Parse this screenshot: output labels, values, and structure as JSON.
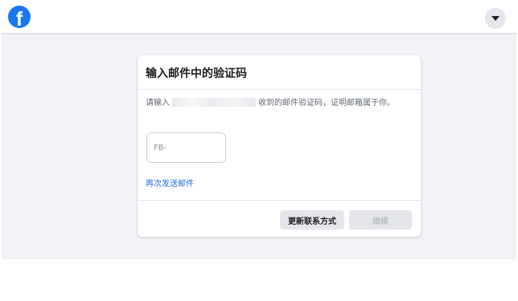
{
  "header": {
    "logo_letter": "f",
    "menu_icon": "caret-down-icon"
  },
  "dialog": {
    "title": "输入邮件中的验证码",
    "description_prefix": "请输入",
    "description_suffix": "收到的邮件验证码，证明邮箱属于你。",
    "code_placeholder": "FB-",
    "code_value": "",
    "resend_link": "再次发送邮件",
    "update_contact_button": "更新联系方式",
    "continue_button": "继续"
  },
  "colors": {
    "brand": "#1877f2",
    "link": "#216fdb",
    "page_background": "#f0f2f5"
  }
}
